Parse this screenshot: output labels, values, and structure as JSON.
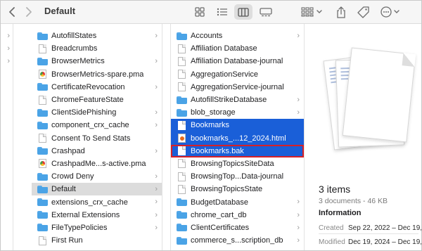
{
  "toolbar": {
    "title": "Default",
    "back_icon": "chevron-left-icon",
    "forward_icon": "chevron-right-icon",
    "views": [
      "icon-view",
      "list-view",
      "column-view",
      "gallery-view"
    ],
    "active_view": "column-view"
  },
  "column0": {
    "items": [
      {
        "chev": "›"
      },
      {
        "chev": "›"
      },
      {
        "chev": "›"
      }
    ]
  },
  "column1": {
    "items": [
      {
        "label": "AutofillStates",
        "type": "folder",
        "chev": "›"
      },
      {
        "label": "Breadcrumbs",
        "type": "doc",
        "chev": ""
      },
      {
        "label": "BrowserMetrics",
        "type": "folder",
        "chev": "›"
      },
      {
        "label": "BrowserMetrics-spare.pma",
        "type": "chrome",
        "chev": ""
      },
      {
        "label": "CertificateRevocation",
        "type": "folder",
        "chev": "›"
      },
      {
        "label": "ChromeFeatureState",
        "type": "doc",
        "chev": ""
      },
      {
        "label": "ClientSidePhishing",
        "type": "folder",
        "chev": "›"
      },
      {
        "label": "component_crx_cache",
        "type": "folder",
        "chev": "›"
      },
      {
        "label": "Consent To Send Stats",
        "type": "doc",
        "chev": ""
      },
      {
        "label": "Crashpad",
        "type": "folder",
        "chev": "›"
      },
      {
        "label": "CrashpadMe...s-active.pma",
        "type": "chrome",
        "chev": ""
      },
      {
        "label": "Crowd Deny",
        "type": "folder",
        "chev": "›"
      },
      {
        "label": "Default",
        "type": "folder",
        "chev": "›",
        "selected": true
      },
      {
        "label": "extensions_crx_cache",
        "type": "folder",
        "chev": "›"
      },
      {
        "label": "External Extensions",
        "type": "folder",
        "chev": "›"
      },
      {
        "label": "FileTypePolicies",
        "type": "folder",
        "chev": "›"
      },
      {
        "label": "First Run",
        "type": "doc",
        "chev": ""
      }
    ]
  },
  "column2": {
    "items": [
      {
        "label": "Accounts",
        "type": "folder",
        "chev": "›"
      },
      {
        "label": "Affiliation Database",
        "type": "doc",
        "chev": ""
      },
      {
        "label": "Affiliation Database-journal",
        "type": "doc",
        "chev": ""
      },
      {
        "label": "AggregationService",
        "type": "doc",
        "chev": ""
      },
      {
        "label": "AggregationService-journal",
        "type": "doc",
        "chev": ""
      },
      {
        "label": "AutofillStrikeDatabase",
        "type": "folder",
        "chev": "›"
      },
      {
        "label": "blob_storage",
        "type": "folder",
        "chev": "›"
      },
      {
        "label": "Bookmarks",
        "type": "doc",
        "chev": "",
        "selected": true
      },
      {
        "label": "bookmarks_...12_2024.html",
        "type": "html",
        "chev": "",
        "selected": true
      },
      {
        "label": "Bookmarks.bak",
        "type": "doc",
        "chev": "",
        "selected": true,
        "outlined": true
      },
      {
        "label": "BrowsingTopicsSiteData",
        "type": "doc",
        "chev": ""
      },
      {
        "label": "BrowsingTop...Data-journal",
        "type": "doc",
        "chev": ""
      },
      {
        "label": "BrowsingTopicsState",
        "type": "doc",
        "chev": ""
      },
      {
        "label": "BudgetDatabase",
        "type": "folder",
        "chev": "›"
      },
      {
        "label": "chrome_cart_db",
        "type": "folder",
        "chev": "›"
      },
      {
        "label": "ClientCertificates",
        "type": "folder",
        "chev": "›"
      },
      {
        "label": "commerce_s...scription_db",
        "type": "folder",
        "chev": "›"
      }
    ]
  },
  "preview": {
    "count": "3 items",
    "subtitle": "3 documents - 46 KB",
    "info_heading": "Information",
    "created_label": "Created",
    "created_value": "Sep 22, 2022 – Dec 19,",
    "modified_label": "Modified",
    "modified_value": "Dec 19, 2024 – Dec 19,"
  },
  "colors": {
    "selection_blue": "#1a5fd8",
    "selection_gray": "#dcdcdc",
    "highlight_outline": "#d62027",
    "folder_blue": "#4aa3e6"
  }
}
